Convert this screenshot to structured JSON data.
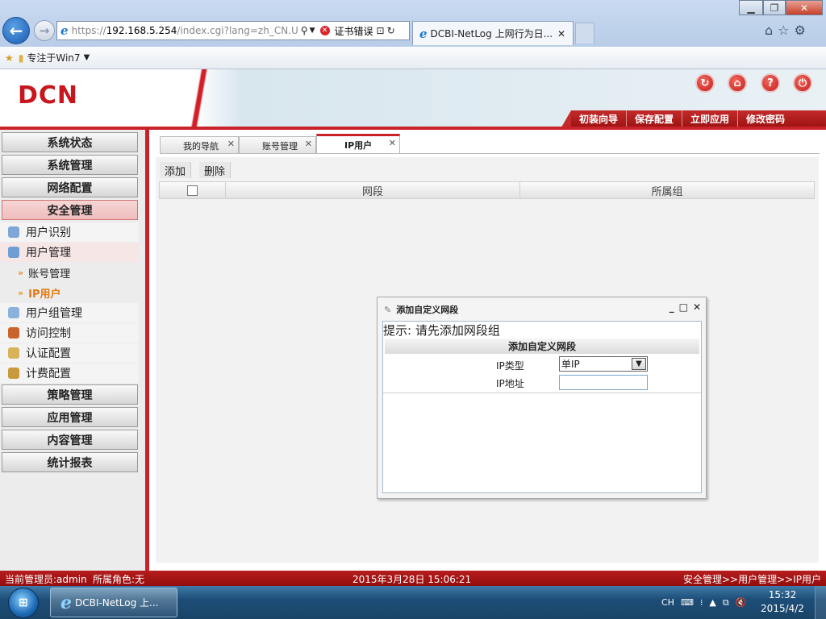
{
  "browser": {
    "url_prefix": "https://",
    "url_host": "192.168.5.254",
    "url_rest": "/index.cgi?lang=zh_CN.U",
    "cert_error": "证书错误",
    "tab_title": "DCBI-NetLog 上网行为日...",
    "favorites_item": "专注于Win7",
    "win_min": "▁",
    "win_max": "❐",
    "win_close": "✕"
  },
  "header": {
    "logo": "DCN",
    "nav": [
      "初装向导",
      "保存配置",
      "立即应用",
      "修改密码"
    ],
    "icons": [
      "refresh-icon",
      "home-icon",
      "help-icon",
      "logout-icon"
    ]
  },
  "sidebar": {
    "sections_top": [
      "系统状态",
      "系统管理",
      "网络配置",
      "安全管理"
    ],
    "security_items": [
      "用户识别",
      "用户管理"
    ],
    "user_mgmt_sub": [
      "账号管理",
      "IP用户"
    ],
    "security_items2": [
      "用户组管理",
      "访问控制",
      "认证配置",
      "计费配置"
    ],
    "sections_bottom": [
      "策略管理",
      "应用管理",
      "内容管理",
      "统计报表"
    ]
  },
  "page_tabs": [
    "我的导航",
    "账号管理",
    "IP用户"
  ],
  "toolbar": {
    "add": "添加",
    "delete": "删除"
  },
  "grid": {
    "columns": [
      "网段",
      "所属组"
    ]
  },
  "dialog": {
    "title": "添加自定义网段",
    "hint": "提示: 请先添加网段组",
    "form_title": "添加自定义网段",
    "ip_type_label": "IP类型",
    "ip_type_value": "单IP",
    "ip_addr_label": "IP地址",
    "ip_addr_value": ""
  },
  "status": {
    "admin": "当前管理员:admin",
    "role": "所属角色:无",
    "datetime": "2015年3月28日 15:06:21",
    "breadcrumb": "安全管理>>用户管理>>IP用户"
  },
  "taskbar": {
    "task_title": "DCBI-NetLog 上...",
    "lang": "CH",
    "time": "15:32",
    "date": "2015/4/2"
  },
  "colors": {
    "brand_red": "#c9222a",
    "accent_blue": "#1a5bb0"
  }
}
